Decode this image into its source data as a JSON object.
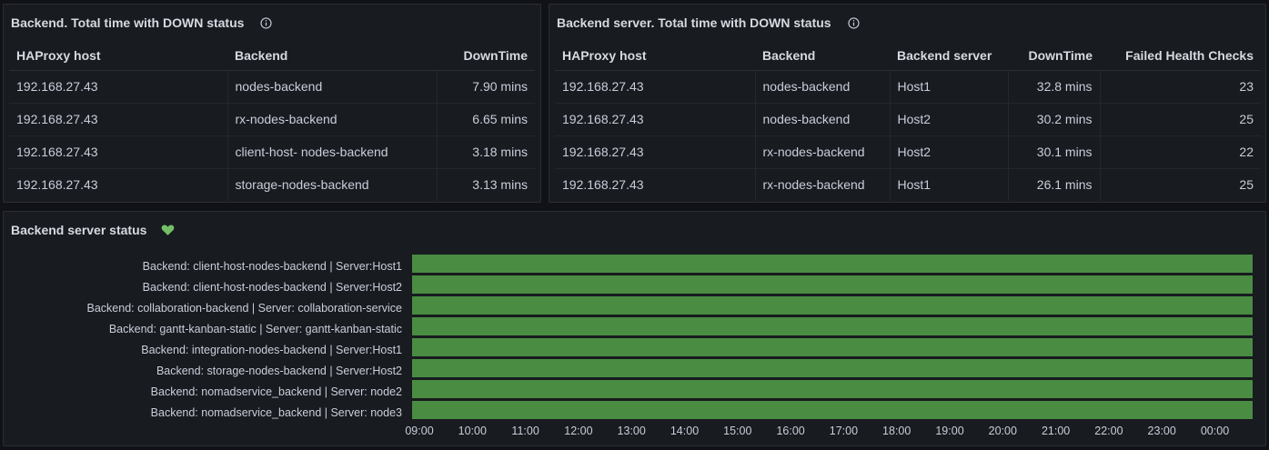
{
  "panel1": {
    "title": "Backend. Total time with DOWN status",
    "columns": [
      "HAProxy host",
      "Backend",
      "DownTime"
    ],
    "rows": [
      [
        "192.168.27.43",
        "nodes-backend",
        "7.90 mins"
      ],
      [
        "192.168.27.43",
        "rx-nodes-backend",
        "6.65 mins"
      ],
      [
        "192.168.27.43",
        "client-host- nodes-backend",
        "3.18 mins"
      ],
      [
        "192.168.27.43",
        "storage-nodes-backend",
        "3.13 mins"
      ]
    ]
  },
  "panel2": {
    "title": "Backend server. Total time with DOWN status",
    "columns": [
      "HAProxy host",
      "Backend",
      "Backend server",
      "DownTime",
      "Failed Health Checks"
    ],
    "rows": [
      [
        "192.168.27.43",
        "nodes-backend",
        "Host1",
        "32.8 mins",
        "23"
      ],
      [
        "192.168.27.43",
        "nodes-backend",
        "Host2",
        "30.2 mins",
        "25"
      ],
      [
        "192.168.27.43",
        "rx-nodes-backend",
        "Host2",
        "30.1 mins",
        "22"
      ],
      [
        "192.168.27.43",
        "rx-nodes-backend",
        "Host1",
        "26.1 mins",
        "25"
      ]
    ]
  },
  "panel3": {
    "title": "Backend server status",
    "status_color": "#56a64b",
    "icon": "heart-icon",
    "rows": [
      "Backend: client-host-nodes-backend | Server:Host1",
      "Backend: client-host-nodes-backend | Server:Host2",
      "Backend: collaboration-backend | Server: collaboration-service",
      "Backend: gantt-kanban-static | Server: gantt-kanban-static",
      "Backend: integration-nodes-backend | Server:Host1",
      "Backend: storage-nodes-backend | Server:Host2",
      "Backend: nomadservice_backend | Server: node2",
      "Backend: nomadservice_backend | Server: node3"
    ],
    "ticks": [
      "09:00",
      "10:00",
      "11:00",
      "12:00",
      "13:00",
      "14:00",
      "15:00",
      "16:00",
      "17:00",
      "18:00",
      "19:00",
      "20:00",
      "21:00",
      "22:00",
      "23:00",
      "00:00"
    ]
  },
  "colors": {
    "background": "#111217",
    "panel": "#181b1f",
    "up": "#56a64b",
    "heart": "#73bf69"
  }
}
